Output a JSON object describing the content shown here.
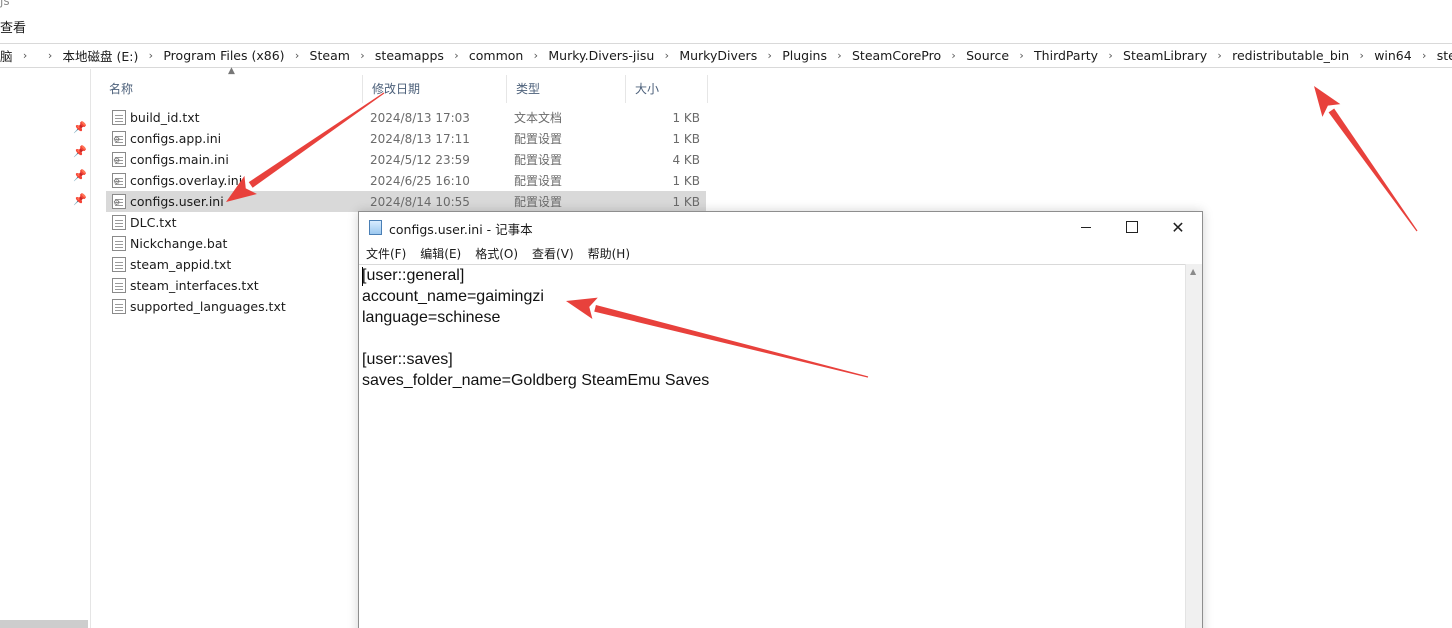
{
  "ribbon": {
    "partial_title": "js",
    "tab_view": "查看"
  },
  "breadcrumb": [
    "脑",
    "本地磁盘 (E:)",
    "Program Files (x86)",
    "Steam",
    "steamapps",
    "common",
    "Murky.Divers-jisu",
    "MurkyDivers",
    "Plugins",
    "SteamCorePro",
    "Source",
    "ThirdParty",
    "SteamLibrary",
    "redistributable_bin",
    "win64",
    "steam_settings"
  ],
  "columns": {
    "name": "名称",
    "date": "修改日期",
    "type": "类型",
    "size": "大小"
  },
  "files": [
    {
      "name": "build_id.txt",
      "date": "2024/8/13 17:03",
      "type": "文本文档",
      "size": "1 KB",
      "icon": "text-file-icon"
    },
    {
      "name": "configs.app.ini",
      "date": "2024/8/13 17:11",
      "type": "配置设置",
      "size": "1 KB",
      "icon": "ini-file-icon"
    },
    {
      "name": "configs.main.ini",
      "date": "2024/5/12 23:59",
      "type": "配置设置",
      "size": "4 KB",
      "icon": "ini-file-icon"
    },
    {
      "name": "configs.overlay.ini",
      "date": "2024/6/25 16:10",
      "type": "配置设置",
      "size": "1 KB",
      "icon": "ini-file-icon"
    },
    {
      "name": "configs.user.ini",
      "date": "2024/8/14 10:55",
      "type": "配置设置",
      "size": "1 KB",
      "icon": "ini-file-icon",
      "selected": true
    },
    {
      "name": "DLC.txt",
      "icon": "text-file-icon"
    },
    {
      "name": "Nickchange.bat",
      "icon": "batch-file-icon"
    },
    {
      "name": "steam_appid.txt",
      "icon": "text-file-icon"
    },
    {
      "name": "steam_interfaces.txt",
      "icon": "text-file-icon"
    },
    {
      "name": "supported_languages.txt",
      "icon": "text-file-icon"
    }
  ],
  "notepad": {
    "title": "configs.user.ini - 记事本",
    "menu": [
      "文件(F)",
      "编辑(E)",
      "格式(O)",
      "查看(V)",
      "帮助(H)"
    ],
    "lines": [
      "[user::general]",
      "account_name=gaimingzi",
      "language=schinese",
      "",
      "[user::saves]",
      "saves_folder_name=Goldberg SteamEmu Saves"
    ]
  },
  "annotation_color": "#e8413c"
}
